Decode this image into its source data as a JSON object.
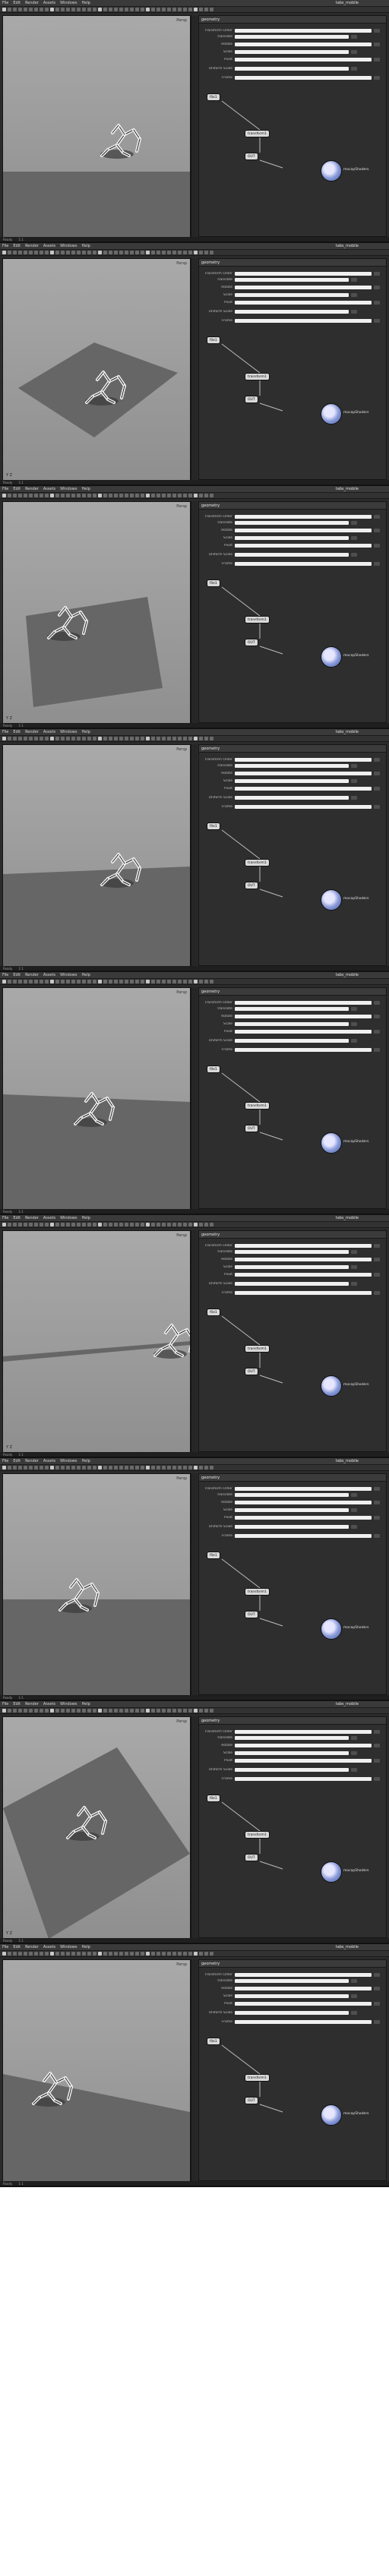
{
  "window": {
    "title": "tabs_mobile",
    "menu": [
      "File",
      "Edit",
      "Render",
      "Assets",
      "Windows",
      "Help"
    ]
  },
  "viewport": {
    "camera_label": "Persp",
    "axis_label": "Y Z"
  },
  "panel": {
    "header": "geometry",
    "params": [
      {
        "label": "Transform Order"
      },
      {
        "label": "Translate"
      },
      {
        "label": "Rotate"
      },
      {
        "label": "Scale"
      },
      {
        "label": "Pivot"
      },
      {
        "label": "Uniform Scale"
      },
      {
        "label": "Frame"
      }
    ],
    "nodes": {
      "input": "file1",
      "mid": "transform1",
      "output": "OUT"
    },
    "output_label": "mocapShaders"
  },
  "status": {
    "left": "Ready",
    "right": "1:1"
  },
  "frames": [
    {
      "id": "f1",
      "floor": "p0"
    },
    {
      "id": "f2",
      "floor": "p1"
    },
    {
      "id": "f3",
      "floor": "p2"
    },
    {
      "id": "f4",
      "floor": "p3"
    },
    {
      "id": "f5",
      "floor": "p4"
    },
    {
      "id": "f6",
      "floor": "p5"
    },
    {
      "id": "f7",
      "floor": "p6"
    },
    {
      "id": "f8",
      "floor": "p7"
    },
    {
      "id": "f9",
      "floor": "p8"
    }
  ],
  "colors": {
    "panel_bg": "#2e2e2e",
    "viewport_top": "#a9a9a9",
    "viewport_bottom": "#8f8f8f",
    "floor": "#666666",
    "node": "#d9d9d9",
    "globe": "#3f5aa8"
  }
}
